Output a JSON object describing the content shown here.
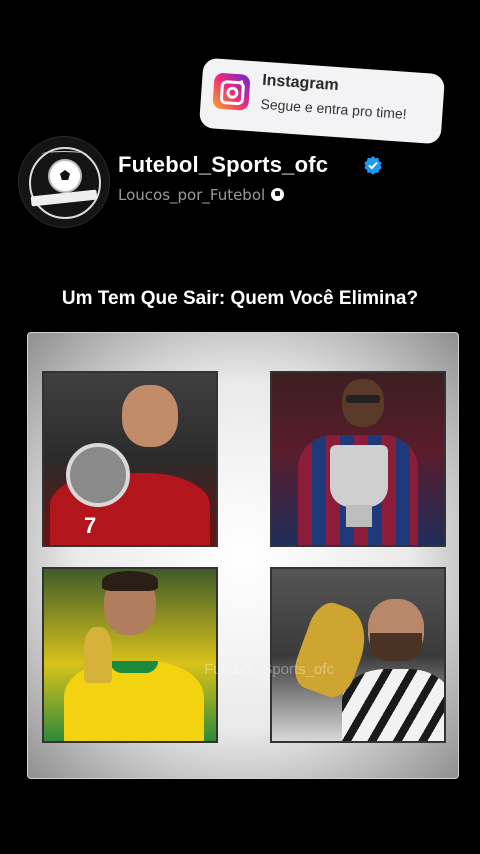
{
  "notification": {
    "app": "Instagram",
    "message": "Segue e entra pro time!",
    "icon": "instagram-icon"
  },
  "profile": {
    "name": "Futebol_Sports_ofc",
    "handle": "Loucos_por_Futebol",
    "verified_icon": "verified-badge-icon",
    "avatar_icon": "soccer-ball-icon",
    "accent": "#1d9bf0"
  },
  "post": {
    "question": "Um Tem Que Sair: Quem Você Elimina?",
    "watermark": "Futebol_Sports_ofc",
    "tile_1_number": "7"
  }
}
